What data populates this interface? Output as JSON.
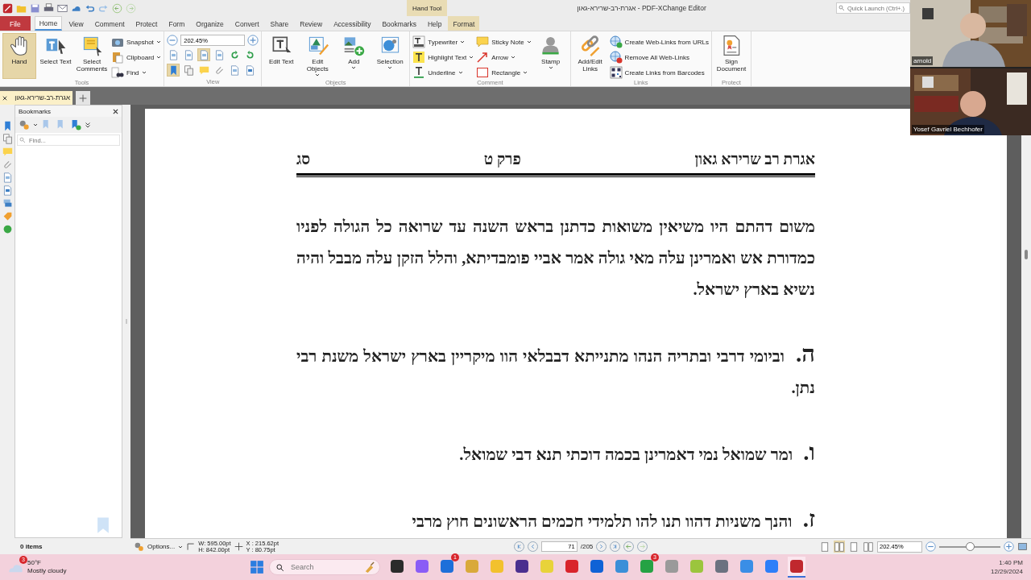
{
  "title_bar": {
    "context_label": "Hand Tool",
    "title": "אגרת-רב-שרירא-גאון - PDF-XChange Editor",
    "quick_launch_placeholder": "Quick Launch (Ctrl+.)"
  },
  "menu_tabs": [
    {
      "label": "File",
      "kind": "file",
      "selected": false
    },
    {
      "label": "Home",
      "kind": "normal",
      "selected": true
    },
    {
      "label": "View",
      "kind": "normal",
      "selected": false
    },
    {
      "label": "Comment",
      "kind": "normal",
      "selected": false
    },
    {
      "label": "Protect",
      "kind": "normal",
      "selected": false
    },
    {
      "label": "Form",
      "kind": "normal",
      "selected": false
    },
    {
      "label": "Organize",
      "kind": "normal",
      "selected": false
    },
    {
      "label": "Convert",
      "kind": "normal",
      "selected": false
    },
    {
      "label": "Share",
      "kind": "normal",
      "selected": false
    },
    {
      "label": "Review",
      "kind": "normal",
      "selected": false
    },
    {
      "label": "Accessibility",
      "kind": "normal",
      "selected": false
    },
    {
      "label": "Bookmarks",
      "kind": "normal",
      "selected": false
    },
    {
      "label": "Help",
      "kind": "normal",
      "selected": false
    },
    {
      "label": "Format",
      "kind": "contextual",
      "selected": false
    }
  ],
  "ribbon": [
    {
      "label": "Tools",
      "items": [
        {
          "kind": "large",
          "label": "Hand",
          "selected": true,
          "dropdown": false
        },
        {
          "kind": "large",
          "label": "Select Text",
          "selected": false,
          "dropdown": false
        },
        {
          "kind": "large",
          "label": "Select Comments",
          "selected": false,
          "dropdown": false
        },
        {
          "kind": "stack",
          "entries": [
            {
              "label": "Snapshot",
              "dropdown": true
            },
            {
              "label": "Clipboard",
              "dropdown": true
            },
            {
              "label": "Find",
              "dropdown": true
            }
          ]
        }
      ]
    },
    {
      "label": "View",
      "items": [
        {
          "kind": "view",
          "zoom": "202.45%",
          "buttons": [
            {
              "selected": false
            },
            {
              "selected": false
            },
            {
              "selected": true
            },
            {
              "selected": false
            },
            {
              "selected": false
            },
            {
              "selected": false
            },
            {
              "selected": true
            },
            {
              "selected": false
            },
            {
              "selected": false
            },
            {
              "selected": false
            },
            {
              "selected": false
            },
            {
              "selected": false
            }
          ]
        }
      ]
    },
    {
      "label": "Objects",
      "items": [
        {
          "kind": "large",
          "label": "Edit Text",
          "selected": false,
          "dropdown": false
        },
        {
          "kind": "large",
          "label": "Edit Objects",
          "selected": false,
          "dropdown": true
        },
        {
          "kind": "large",
          "label": "Add",
          "selected": false,
          "dropdown": true
        },
        {
          "kind": "large",
          "label": "Selection",
          "selected": false,
          "dropdown": true
        }
      ]
    },
    {
      "label": "Comment",
      "items": [
        {
          "kind": "stack",
          "entries": [
            {
              "label": "Typewriter",
              "dropdown": true
            },
            {
              "label": "Highlight Text",
              "dropdown": true
            },
            {
              "label": "Underline",
              "dropdown": true
            }
          ]
        },
        {
          "kind": "stack",
          "entries": [
            {
              "label": "Sticky Note",
              "dropdown": true
            },
            {
              "label": "Arrow",
              "dropdown": true
            },
            {
              "label": "Rectangle",
              "dropdown": true
            }
          ]
        },
        {
          "kind": "large",
          "label": "Stamp",
          "selected": false,
          "dropdown": true
        }
      ]
    },
    {
      "label": "Links",
      "items": [
        {
          "kind": "large",
          "label": "Add/Edit Links",
          "selected": false,
          "dropdown": false
        },
        {
          "kind": "stack",
          "entries": [
            {
              "label": "Create Web-Links from URLs",
              "dropdown": false
            },
            {
              "label": "Remove All Web-Links",
              "dropdown": false
            },
            {
              "label": "Create Links from Barcodes",
              "dropdown": false
            }
          ]
        }
      ]
    },
    {
      "label": "Protect",
      "items": [
        {
          "kind": "large",
          "label": "Sign Document",
          "selected": false,
          "dropdown": false
        }
      ]
    }
  ],
  "document_tabs": [
    {
      "label": "אגרת-רב-שרירא-גאון",
      "selected": true
    }
  ],
  "bookmarks_pane": {
    "title": "Bookmarks",
    "find_placeholder": "Find...",
    "count": "0 items"
  },
  "page": {
    "header": {
      "right": "אגרת רב שרירא גאון",
      "center": "פרק ט",
      "left": "סג"
    },
    "paragraphs": [
      {
        "text": "משום דהתם היו משיאין משואות כדתנן בראש השנה עד שרואה כל הגולה לפניו כמדורת אש ואמרינן עלה מאי גולה אמר אביי פומבדיתא, והלל הזקן עלה מבבל והיה נשיא בארץ ישראל."
      },
      {
        "text": "**ה.** וביומי דרבי ובתריה הנהו מתנייתא דבבלאי הוו מיקריין בארץ ישראל משנת רבי נתן."
      },
      {
        "text": "**ו.** ומר שמואל נמי דאמרינן בכמה דוכתי תנא דבי שמואל."
      },
      {
        "text": "**ז.** והנך משניות דהוו תנו להו תלמידי חכמים הראשונים חוץ מרבי"
      }
    ]
  },
  "status_bar": {
    "options": "Options...",
    "width": "W: 595.00pt",
    "height": "H: 842.00pt",
    "x": "X : 215.62pt",
    "y": "Y : 80.75pt",
    "page": "71",
    "page_count": "/205",
    "layouts": [
      {
        "selected": false
      },
      {
        "selected": true
      },
      {
        "selected": false
      },
      {
        "selected": false
      }
    ],
    "zoom": "202.45%",
    "zoom_slider": {
      "level": 0.5
    }
  },
  "video_call": {
    "participants": [
      {
        "name": "arnold"
      },
      {
        "name": "Yosef Gavriel Bechhofer"
      }
    ]
  },
  "taskbar": {
    "weather": {
      "badge": "3",
      "temperature": "50°F",
      "condition": "Mostly cloudy"
    },
    "search_placeholder": "Search",
    "apps": [
      {
        "color": "#2b2b2b",
        "selected": false
      },
      {
        "color": "#8a5cf6",
        "selected": false
      },
      {
        "color": "#1e6fd9",
        "badge": "1",
        "selected": false
      },
      {
        "color": "#d9a93a",
        "selected": false
      },
      {
        "color": "#f2c12e",
        "selected": false
      },
      {
        "color": "#4b2f8f",
        "selected": false
      },
      {
        "color": "#e8d33a",
        "selected": false
      },
      {
        "color": "#d9242b",
        "selected": false
      },
      {
        "color": "#0f62d6",
        "selected": false
      },
      {
        "color": "#3b8fd8",
        "selected": false
      },
      {
        "color": "#25a244",
        "badge": "3",
        "selected": false
      },
      {
        "color": "#9a9a9a",
        "selected": false
      },
      {
        "color": "#9bc53d",
        "selected": false
      },
      {
        "color": "#6b7280",
        "selected": false
      },
      {
        "color": "#3a8ee6",
        "selected": false
      },
      {
        "color": "#2d7ff9",
        "selected": false
      },
      {
        "color": "#c0282e",
        "selected": true
      }
    ],
    "time": "1:40 PM",
    "date": "12/29/2024"
  }
}
